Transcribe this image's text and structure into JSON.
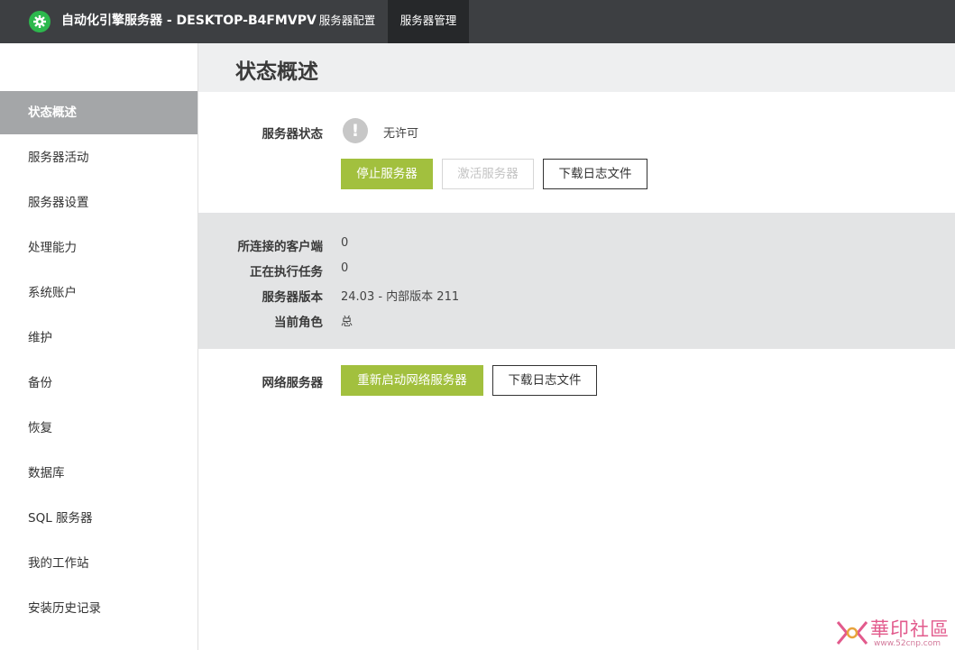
{
  "header": {
    "app_title": "自动化引擎服务器 - DESKTOP-B4FMVPV",
    "logo_icon": "gear-icon",
    "tabs": [
      "服务器配置",
      "服务器管理"
    ],
    "active_tab": "服务器管理"
  },
  "sidebar": {
    "items": [
      {
        "label": "状态概述",
        "active": true
      },
      {
        "label": "服务器活动"
      },
      {
        "label": "服务器设置"
      },
      {
        "label": "处理能力"
      },
      {
        "label": "系统账户"
      },
      {
        "label": "维护"
      },
      {
        "label": "备份"
      },
      {
        "label": "恢复"
      },
      {
        "label": "数据库"
      },
      {
        "label": "SQL 服务器"
      },
      {
        "label": "我的工作站"
      },
      {
        "label": "安装历史记录"
      }
    ]
  },
  "main": {
    "title": "状态概述",
    "server_status": {
      "label": "服务器状态",
      "icon": "exclamation-icon",
      "value": "无许可",
      "buttons": {
        "stop": "停止服务器",
        "activate": "激活服务器",
        "download_log": "下载日志文件"
      }
    },
    "info": {
      "clients_label": "所连接的客户端",
      "clients_value": "0",
      "tasks_label": "正在执行任务",
      "tasks_value": "0",
      "version_label": "服务器版本",
      "version_value": "24.03 - 内部版本 211",
      "role_label": "当前角色",
      "role_value": "总"
    },
    "web_server": {
      "label": "网络服务器",
      "restart": "重新启动网络服务器",
      "download_log": "下载日志文件"
    }
  },
  "watermark": {
    "text": "華印社區",
    "url": "www.52cnp.com"
  },
  "colors": {
    "topbar": "#3d3f42",
    "active_tab": "#26282a",
    "logo": "#2db84d",
    "primary_button": "#a2c03e",
    "sidebar_active": "#a4a6a8",
    "info_panel": "#e3e4e5"
  }
}
